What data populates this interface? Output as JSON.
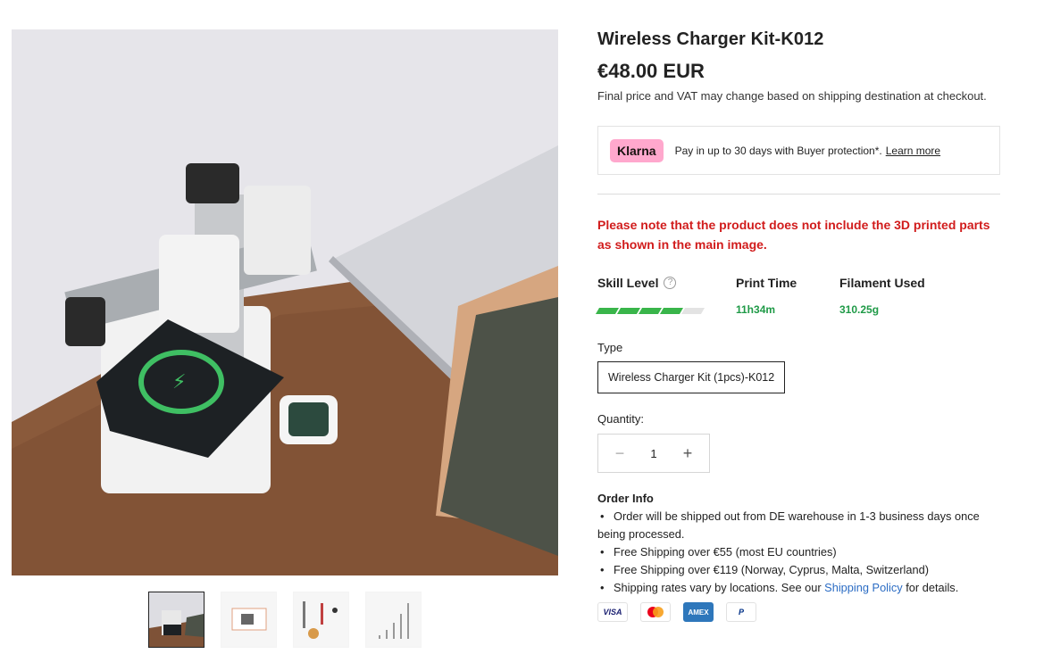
{
  "product": {
    "title": "Wireless Charger Kit-K012",
    "price": "€48.00 EUR",
    "price_note": "Final price and VAT may change based on shipping destination at checkout."
  },
  "klarna": {
    "logo": "Klarna",
    "text": "Pay in up to 30 days with Buyer protection*.",
    "link": "Learn more"
  },
  "notice": "Please note that the product does not include the 3D printed parts as shown in the main image.",
  "stats": {
    "skill_label": "Skill Level",
    "skill_level_filled": 4,
    "skill_level_total": 5,
    "print_time_label": "Print Time",
    "print_time_value": "11h34m",
    "filament_label": "Filament Used",
    "filament_value": "310.25g"
  },
  "type": {
    "label": "Type",
    "selected": "Wireless Charger Kit (1pcs)-K012"
  },
  "quantity": {
    "label": "Quantity:",
    "value": "1",
    "minus": "−",
    "plus": "+"
  },
  "order_info": {
    "title": "Order Info",
    "items": [
      "Order will be shipped out from DE warehouse in 1-3 business days once being processed.",
      "Free Shipping over €55 (most EU countries)",
      "Free Shipping over €119 (Norway, Cyprus, Malta, Switzerland)"
    ],
    "last_item_prefix": "Shipping rates vary by locations. See our ",
    "last_item_link": "Shipping Policy",
    "last_item_suffix": " for details."
  },
  "payments": {
    "visa": "VISA",
    "amex": "AMEX",
    "paypal": "P"
  },
  "colors": {
    "notice_red": "#d11c1c",
    "stat_green": "#1f9a47",
    "klarna_pink": "#ffa8cd",
    "link_blue": "#2b6cc4"
  },
  "gallery": {
    "thumbnail_count": 4,
    "active_index": 0
  }
}
